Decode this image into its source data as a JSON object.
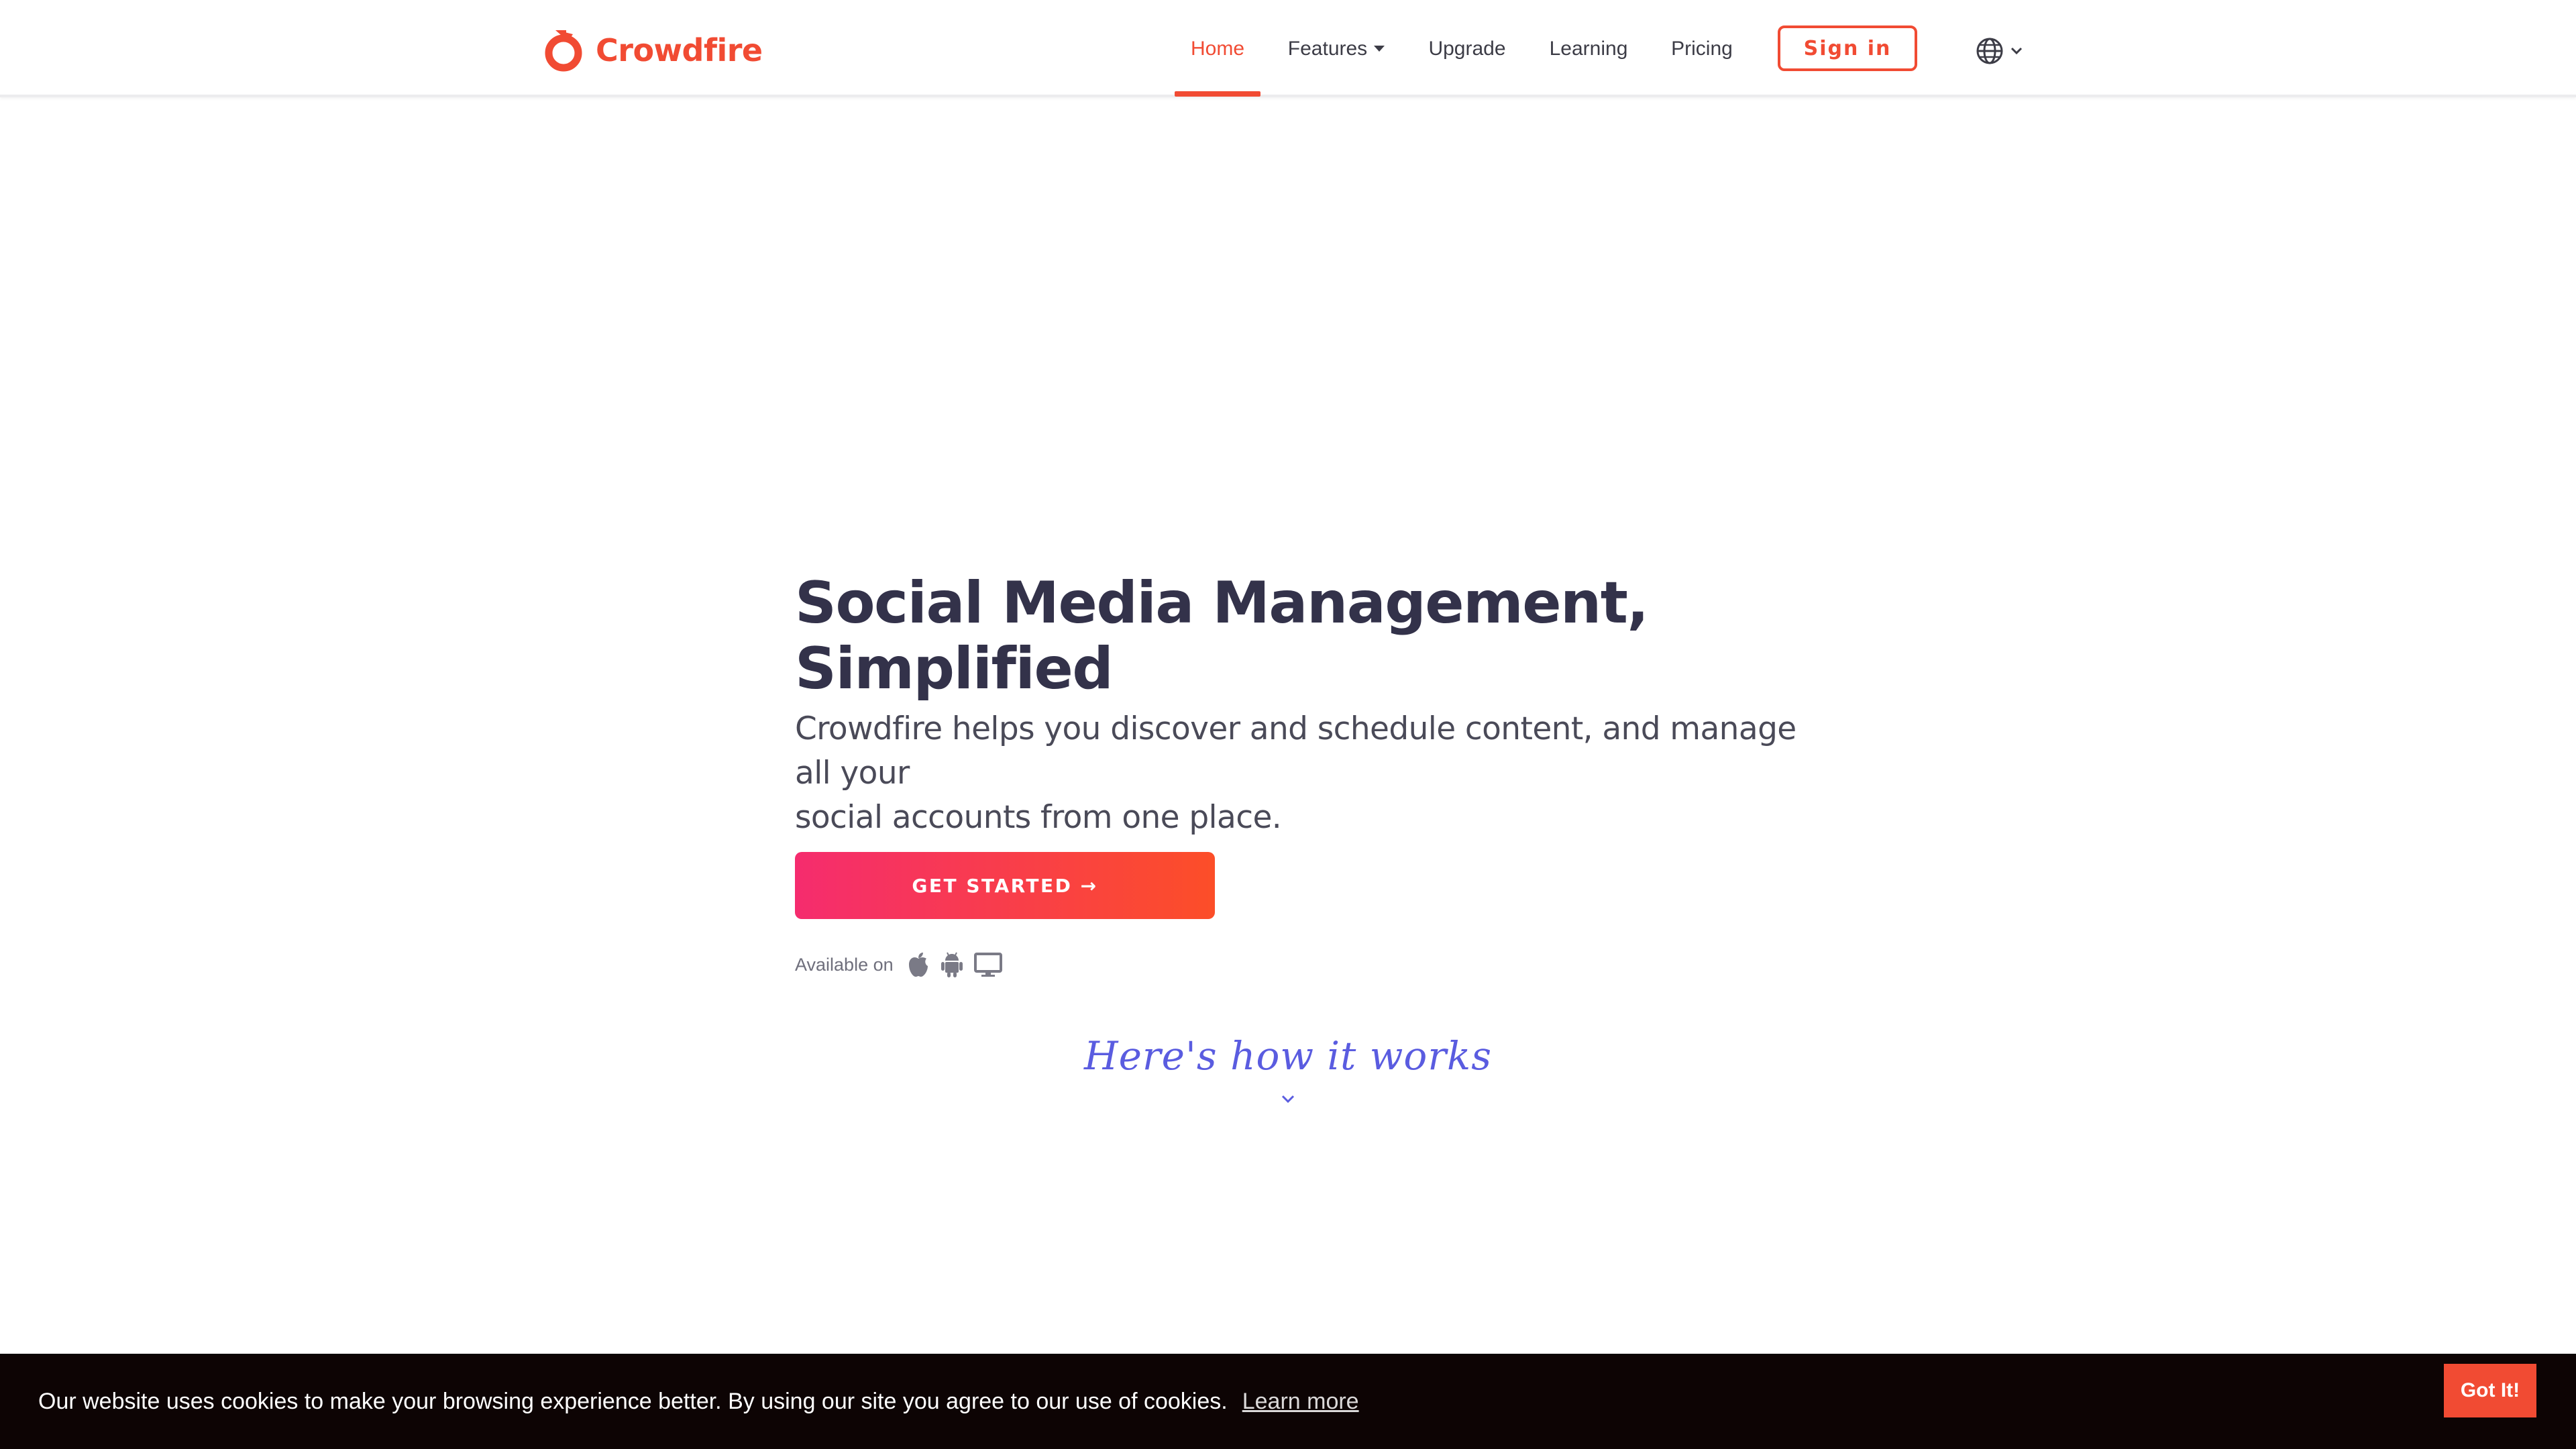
{
  "brand": {
    "name": "Crowdfire",
    "accent_color": "#f14b33"
  },
  "nav": {
    "items": [
      {
        "label": "Home",
        "active": true
      },
      {
        "label": "Features",
        "has_dropdown": true
      },
      {
        "label": "Upgrade"
      },
      {
        "label": "Learning"
      },
      {
        "label": "Pricing"
      }
    ],
    "signin_label": "Sign in",
    "language_icon": "globe-icon"
  },
  "hero": {
    "title_line1": "Social Media Management,",
    "title_line2": "Simplified",
    "subtitle_line1": "Crowdfire helps you discover and schedule content, and manage all your",
    "subtitle_line2": "social accounts from one place.",
    "cta_label": "GET STARTED →",
    "cta_gradient": [
      "#f52c6e",
      "#fc4e28"
    ],
    "available_label": "Available on",
    "platform_icons": [
      "apple-icon",
      "android-icon",
      "desktop-icon"
    ]
  },
  "how_it_works": {
    "label": "Here's how it works",
    "color": "#5a5ce0"
  },
  "cookie": {
    "message": "Our website uses cookies to make your browsing experience better. By using our site you agree to our use of cookies.",
    "learn_more_label": "Learn more",
    "accept_label": "Got It!"
  }
}
